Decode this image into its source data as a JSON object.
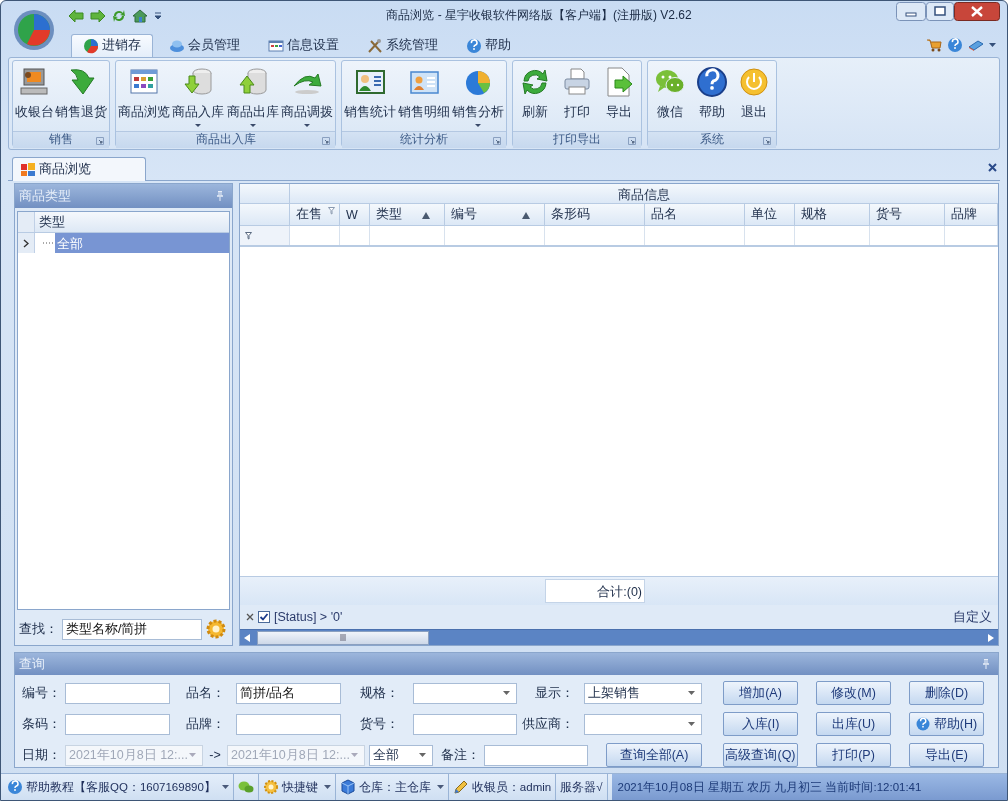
{
  "window": {
    "title": "商品浏览 - 星宇收银软件网络版【客户端】(注册版) V2.62"
  },
  "ribbon_tabs": [
    {
      "label": "进销存",
      "selected": true
    },
    {
      "label": "会员管理",
      "selected": false
    },
    {
      "label": "信息设置",
      "selected": false
    },
    {
      "label": "系统管理",
      "selected": false
    },
    {
      "label": "帮助",
      "selected": false
    }
  ],
  "ribbon_groups": [
    {
      "title": "销售",
      "buttons": [
        {
          "label": "收银台",
          "has_menu": false
        },
        {
          "label": "销售退货",
          "has_menu": false
        }
      ]
    },
    {
      "title": "商品出入库",
      "buttons": [
        {
          "label": "商品浏览",
          "has_menu": false
        },
        {
          "label": "商品入库",
          "has_menu": true
        },
        {
          "label": "商品出库",
          "has_menu": true
        },
        {
          "label": "商品调拨",
          "has_menu": true
        }
      ]
    },
    {
      "title": "统计分析",
      "buttons": [
        {
          "label": "销售统计",
          "has_menu": false
        },
        {
          "label": "销售明细",
          "has_menu": false
        },
        {
          "label": "销售分析",
          "has_menu": true
        }
      ]
    },
    {
      "title": "打印导出",
      "buttons": [
        {
          "label": "刷新",
          "has_menu": false
        },
        {
          "label": "打印",
          "has_menu": false
        },
        {
          "label": "导出",
          "has_menu": false
        }
      ]
    },
    {
      "title": "系统",
      "buttons": [
        {
          "label": "微信",
          "has_menu": false
        },
        {
          "label": "帮助",
          "has_menu": false
        },
        {
          "label": "退出",
          "has_menu": false
        }
      ]
    }
  ],
  "document_tabs": [
    {
      "label": "商品浏览",
      "selected": true
    }
  ],
  "category_panel": {
    "title": "商品类型",
    "column": "类型",
    "tree": [
      {
        "label": "全部",
        "selected": true
      }
    ],
    "search_label": "查找：",
    "search_value": "类型名称/简拼"
  },
  "grid": {
    "group_header": "商品信息",
    "columns": [
      {
        "label": "在售",
        "sorted": false,
        "filtered": true
      },
      {
        "label": "W",
        "sorted": false,
        "filtered": false
      },
      {
        "label": "类型",
        "sorted": true,
        "filtered": false
      },
      {
        "label": "编号",
        "sorted": true,
        "filtered": false
      },
      {
        "label": "条形码",
        "sorted": false,
        "filtered": false
      },
      {
        "label": "品名",
        "sorted": false,
        "filtered": false
      },
      {
        "label": "单位",
        "sorted": false,
        "filtered": false
      },
      {
        "label": "规格",
        "sorted": false,
        "filtered": false
      },
      {
        "label": "货号",
        "sorted": false,
        "filtered": false
      },
      {
        "label": "品牌",
        "sorted": false,
        "filtered": false
      }
    ],
    "total": "合计:(0)",
    "filter": {
      "checked": true,
      "text": "[Status] > '0'"
    },
    "customize": "自定义"
  },
  "query_panel": {
    "title": "查询",
    "rows": [
      [
        {
          "kind": "label",
          "text": "编号："
        },
        {
          "kind": "input"
        },
        {
          "kind": "label",
          "text": "品名："
        },
        {
          "kind": "input",
          "value": "简拼/品名"
        },
        {
          "kind": "label",
          "text": "规格："
        },
        {
          "kind": "select"
        },
        {
          "kind": "label",
          "text": "显示："
        },
        {
          "kind": "select",
          "value": "上架销售"
        },
        {
          "kind": "button",
          "label": "增加(A)"
        },
        {
          "kind": "button",
          "label": "修改(M)"
        },
        {
          "kind": "button",
          "label": "删除(D)"
        }
      ],
      [
        {
          "kind": "label",
          "text": "条码："
        },
        {
          "kind": "input"
        },
        {
          "kind": "label",
          "text": "品牌："
        },
        {
          "kind": "input"
        },
        {
          "kind": "label",
          "text": "货号："
        },
        {
          "kind": "input"
        },
        {
          "kind": "label",
          "text": "供应商："
        },
        {
          "kind": "select"
        },
        {
          "kind": "button",
          "label": "入库(I)"
        },
        {
          "kind": "button",
          "label": "出库(U)"
        },
        {
          "kind": "helpbutton",
          "label": "帮助(H)"
        }
      ],
      [
        {
          "kind": "label",
          "text": "日期："
        },
        {
          "kind": "select",
          "value": "2021年10月8日 12:...",
          "disabled": true
        },
        {
          "kind": "text",
          "text": "->"
        },
        {
          "kind": "select",
          "value": "2021年10月8日 12:...",
          "disabled": true
        },
        {
          "kind": "select",
          "value": "全部"
        },
        {
          "kind": "label",
          "text": "备注："
        },
        {
          "kind": "input"
        },
        {
          "kind": "button",
          "label": "查询全部(A)"
        },
        {
          "kind": "button",
          "label": "高级查询(Q)"
        },
        {
          "kind": "button",
          "label": "打印(P)"
        },
        {
          "kind": "button",
          "label": "导出(E)"
        }
      ]
    ]
  },
  "status_bar": {
    "items": [
      {
        "kind": "help",
        "text": "帮助教程【客服QQ：1607169890】",
        "has_menu": true
      },
      {
        "kind": "wechat",
        "has_menu": false
      },
      {
        "kind": "shortcut",
        "text": "快捷键",
        "has_menu": true
      },
      {
        "kind": "warehouse",
        "text": "仓库：主仓库",
        "has_menu": true
      },
      {
        "kind": "cashier",
        "text": "收银员：admin",
        "has_menu": false
      },
      {
        "kind": "server",
        "text": "服务器√",
        "has_menu": false
      }
    ],
    "clock": "2021年10月08日 星期五 农历 九月初三 当前时间:12:01:41"
  }
}
